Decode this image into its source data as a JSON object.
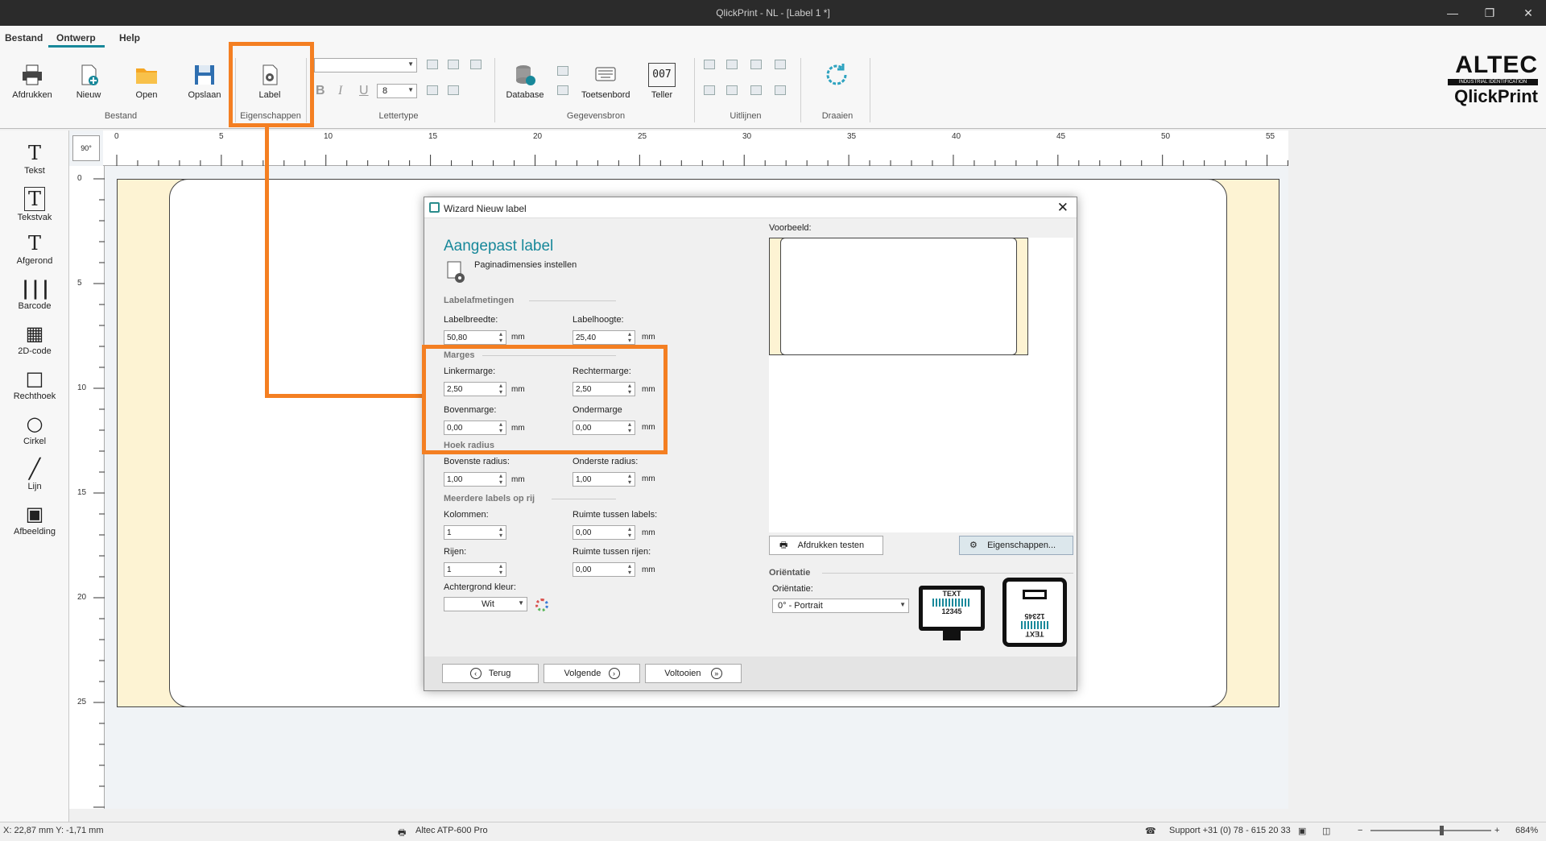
{
  "window": {
    "title": "QlickPrint - NL - [Label 1 *]",
    "min": "—",
    "restore": "❐",
    "close": "✕"
  },
  "menu": {
    "bestand": "Bestand",
    "ontwerp": "Ontwerp",
    "help": "Help"
  },
  "ribbon": {
    "afdrukken": "Afdrukken",
    "nieuw": "Nieuw",
    "open": "Open",
    "opslaan": "Opslaan",
    "group_bestand": "Bestand",
    "label": "Label",
    "group_eigenschappen": "Eigenschappen",
    "font_size": "8",
    "bold": "B",
    "italic": "I",
    "underline": "U",
    "group_lettertype": "Lettertype",
    "database": "Database",
    "toetsenbord": "Toetsenbord",
    "teller": "Teller",
    "teller_icon_text": "007",
    "group_gegevensbron": "Gegevensbron",
    "group_uitlijnen": "Uitlijnen",
    "group_draaien": "Draaien"
  },
  "logo": {
    "brand": "ALTEC",
    "tagline": "INDUSTRIAL IDENTIFICATION",
    "product": "QlickPrint"
  },
  "tools": [
    {
      "label": "Tekst",
      "icon": "T"
    },
    {
      "label": "Tekstvak",
      "icon": "T"
    },
    {
      "label": "Afgerond",
      "icon": "T"
    },
    {
      "label": "Barcode",
      "icon": "|||"
    },
    {
      "label": "2D-code",
      "icon": "▦"
    },
    {
      "label": "Rechthoek",
      "icon": "□"
    },
    {
      "label": "Cirkel",
      "icon": "○"
    },
    {
      "label": "Lijn",
      "icon": "╱"
    },
    {
      "label": "Afbeelding",
      "icon": "▣"
    }
  ],
  "ruler": {
    "h": [
      "0",
      "5",
      "10",
      "15",
      "20",
      "25",
      "30",
      "35",
      "40",
      "45",
      "50",
      "55"
    ],
    "v": [
      "0",
      "5",
      "10",
      "15",
      "20",
      "25"
    ],
    "rotate_button": "90°"
  },
  "dialog": {
    "title": "Wizard Nieuw label",
    "heading": "Aangepast label",
    "subheading": "Paginadimensies instellen",
    "sect_labelafmetingen": "Labelafmetingen",
    "labelbreedte": "Labelbreedte:",
    "labelbreedte_val": "50,80",
    "labelhoogte": "Labelhoogte:",
    "labelhoogte_val": "25,40",
    "sect_marges": "Marges",
    "linkermarge": "Linkermarge:",
    "linkermarge_val": "2,50",
    "rechtermarge": "Rechtermarge:",
    "rechtermarge_val": "2,50",
    "bovenmarge": "Bovenmarge:",
    "bovenmarge_val": "0,00",
    "ondermarge": "Ondermarge",
    "ondermarge_val": "0,00",
    "sect_hoek": "Hoek radius",
    "bovenste_radius": "Bovenste radius:",
    "bovenste_radius_val": "1,00",
    "onderste_radius": "Onderste radius:",
    "onderste_radius_val": "1,00",
    "sect_meerdere": "Meerdere labels op rij",
    "kolommen": "Kolommen:",
    "kolommen_val": "1",
    "ruimte_labels": "Ruimte tussen labels:",
    "ruimte_labels_val": "0,00",
    "rijen": "Rijen:",
    "rijen_val": "1",
    "ruimte_rijen": "Ruimte tussen rijen:",
    "ruimte_rijen_val": "0,00",
    "achtergrond": "Achtergrond kleur:",
    "achtergrond_val": "Wit",
    "unit": "mm",
    "voorbeeld": "Voorbeeld:",
    "afdrukken_testen": "Afdrukken testen",
    "eigenschappen": "Eigenschappen...",
    "sect_orientatie": "Oriëntatie",
    "orientatie": "Oriëntatie:",
    "orientatie_val": "0° - Portrait",
    "printer_text": "TEXT",
    "printer_num": "12345",
    "terug": "Terug",
    "volgende": "Volgende",
    "voltooien": "Voltooien"
  },
  "status": {
    "coords": "X: 22,87 mm Y: -1,71 mm",
    "printer": "Altec ATP-600 Pro",
    "support": "Support +31 (0) 78 - 615 20 33",
    "zoom": "684%",
    "minus": "−",
    "plus": "+"
  },
  "colors": {
    "accent": "#18889a",
    "highlight": "#f47f22",
    "label_bg": "#fdf3d3"
  }
}
